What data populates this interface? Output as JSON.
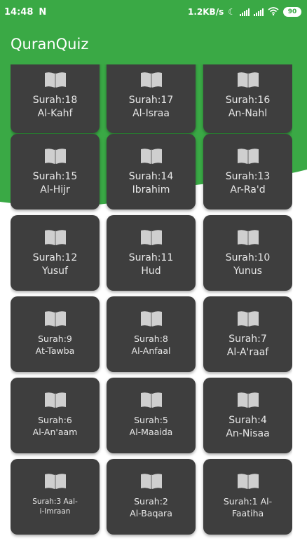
{
  "status": {
    "time": "14:48",
    "notification_icon": "n-notification-icon",
    "network_speed": "1.2KB/s",
    "battery": "90"
  },
  "app": {
    "title": "QuranQuiz",
    "accent": "#3aa945",
    "card_color": "#3e3e3e"
  },
  "surahs": [
    {
      "line1": "Surah:18",
      "line2": "Al-Kahf"
    },
    {
      "line1": "Surah:17",
      "line2": "Al-Israa"
    },
    {
      "line1": "Surah:16",
      "line2": "An-Nahl"
    },
    {
      "line1": "Surah:15",
      "line2": "Al-Hijr"
    },
    {
      "line1": "Surah:14",
      "line2": "Ibrahim"
    },
    {
      "line1": "Surah:13",
      "line2": "Ar-Ra'd"
    },
    {
      "line1": "Surah:12",
      "line2": "Yusuf"
    },
    {
      "line1": "Surah:11",
      "line2": "Hud"
    },
    {
      "line1": "Surah:10",
      "line2": "Yunus"
    },
    {
      "line1": "Surah:9",
      "line2": "At-Tawba"
    },
    {
      "line1": "Surah:8",
      "line2": "Al-Anfaal"
    },
    {
      "line1": "Surah:7",
      "line2": "Al-A'raaf"
    },
    {
      "line1": "Surah:6",
      "line2": "Al-An'aam"
    },
    {
      "line1": "Surah:5",
      "line2": "Al-Maaida"
    },
    {
      "line1": "Surah:4",
      "line2": "An-Nisaa"
    },
    {
      "line1": "Surah:3 Aal-",
      "line2": "i-Imraan"
    },
    {
      "line1": "Surah:2",
      "line2": "Al-Baqara"
    },
    {
      "line1": "Surah:1 Al-",
      "line2": "Faatiha"
    }
  ]
}
